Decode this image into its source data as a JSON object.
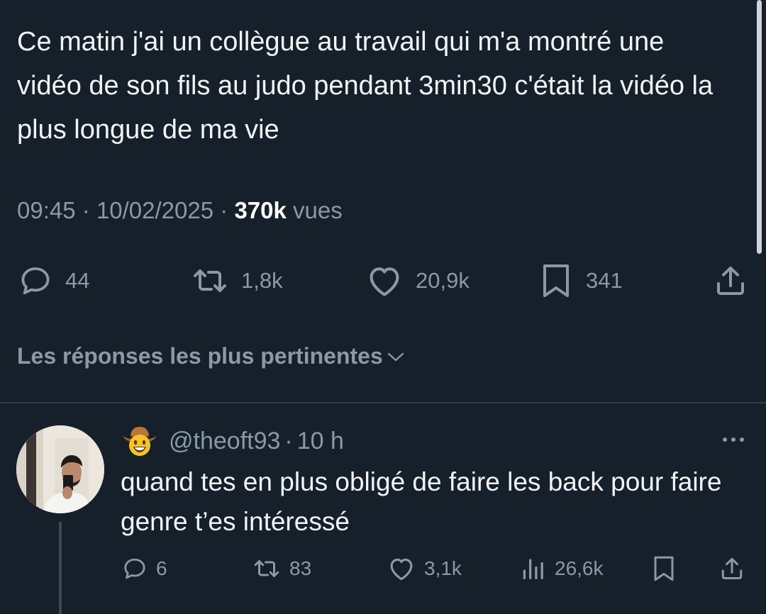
{
  "tweet": {
    "text": "Ce matin j'ai un collègue au travail qui m'a montré une vidéo de son fils au judo pendant 3min30 c'était la vidéo la plus longue de ma vie",
    "time": "09:45",
    "separator": "·",
    "date": "10/02/2025",
    "views_count": "370k",
    "views_label": "vues",
    "replies": "44",
    "retweets": "1,8k",
    "likes": "20,9k",
    "bookmarks": "341"
  },
  "replies_sort": {
    "label": "Les réponses les plus pertinentes"
  },
  "reply": {
    "handle": "@theoft93",
    "separator": "·",
    "time": "10 h",
    "text": "quand tes en plus obligé de faire les back pour faire genre t’es intéressé",
    "replies": "6",
    "retweets": "83",
    "likes": "3,1k",
    "views": "26,6k"
  },
  "icons": {
    "reply": "reply-icon",
    "retweet": "retweet-icon",
    "like": "heart-icon",
    "bookmark": "bookmark-icon",
    "share": "share-icon",
    "views": "analytics-icon",
    "more": "more-icon",
    "sort": "chevron-down-icon",
    "badge": "cowboy-emoji-icon"
  },
  "colors": {
    "background": "#15202b",
    "text": "#f1f3f4",
    "secondary": "#8b98a5",
    "divider": "#2f3b47"
  }
}
